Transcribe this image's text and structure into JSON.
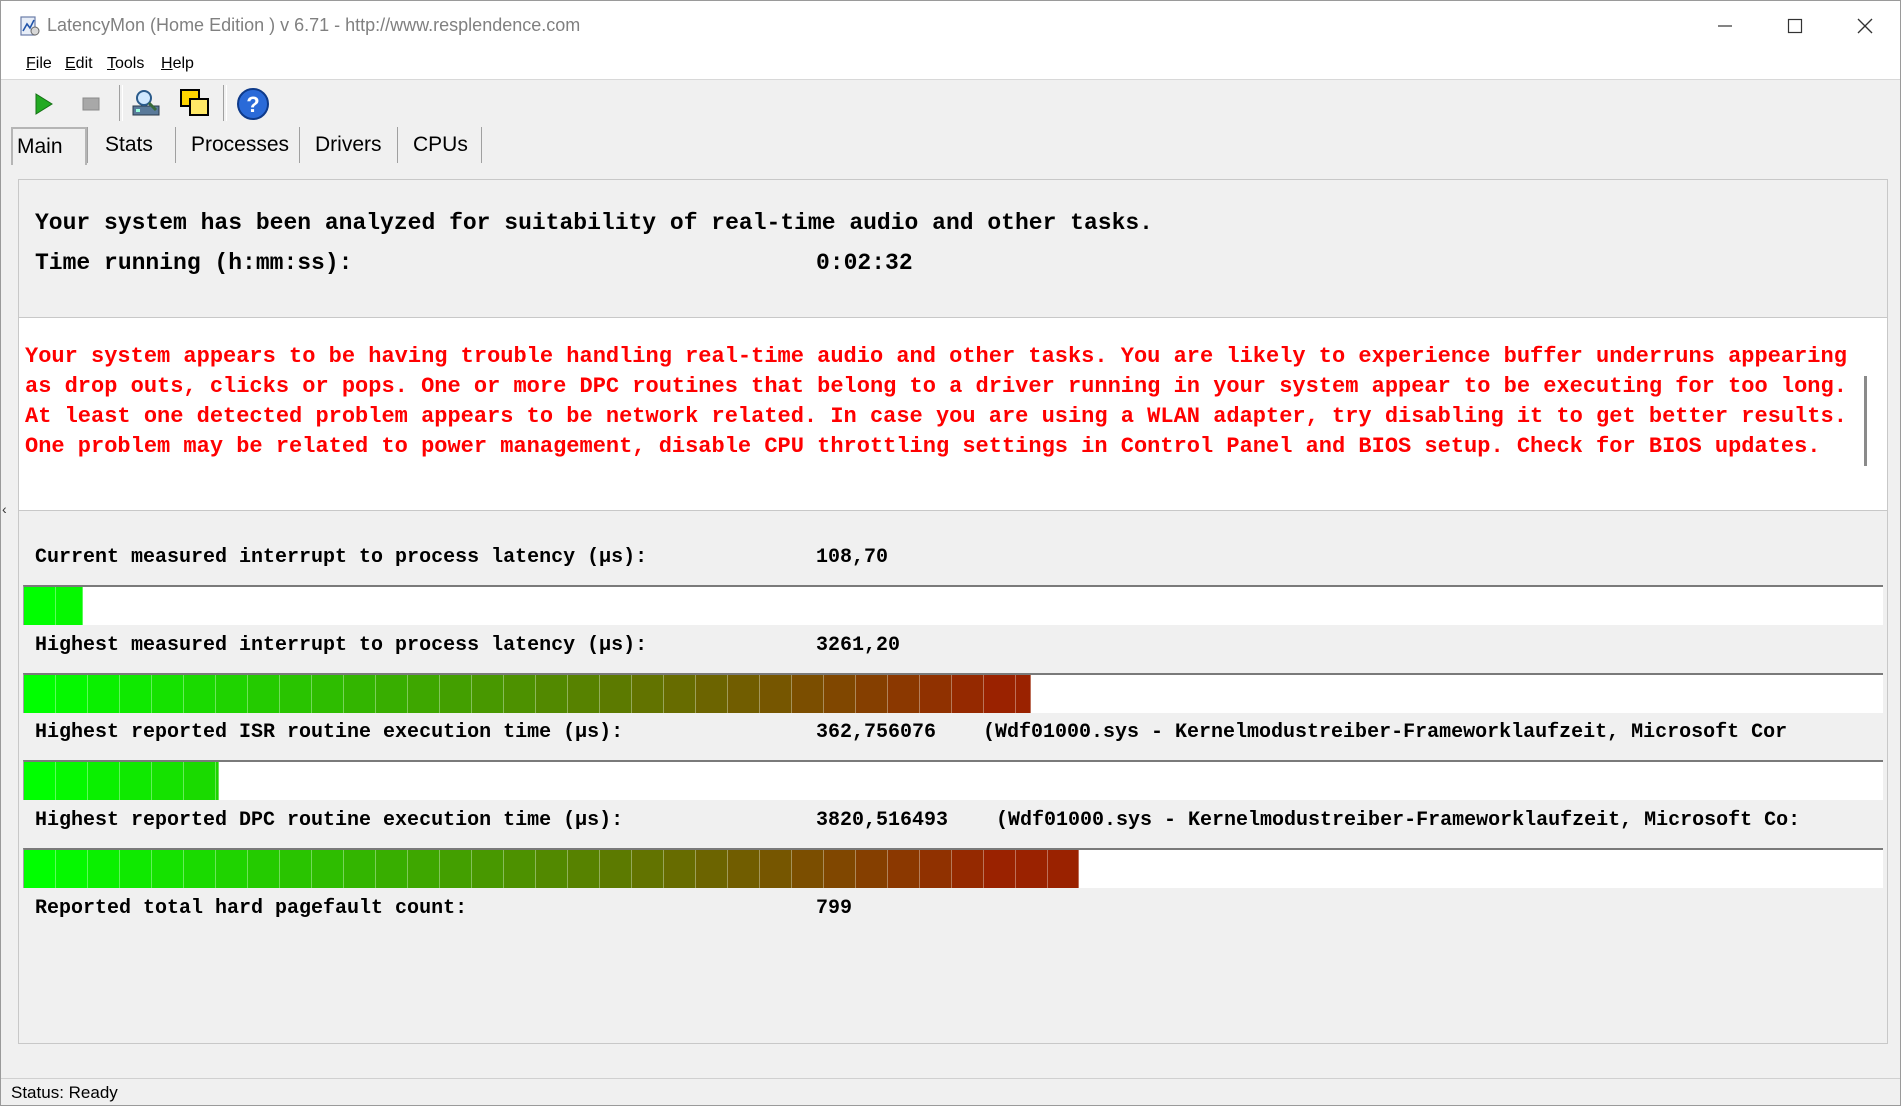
{
  "window": {
    "title": "LatencyMon  (Home Edition )  v 6.71 - http://www.resplendence.com"
  },
  "menu": [
    {
      "label": "File",
      "mnemonic": "F",
      "rest": "ile"
    },
    {
      "label": "Edit",
      "mnemonic": "E",
      "rest": "dit"
    },
    {
      "label": "Tools",
      "mnemonic": "T",
      "rest": "ools"
    },
    {
      "label": "Help",
      "mnemonic": "H",
      "rest": "elp"
    }
  ],
  "toolbar": {
    "icons": [
      "play-icon",
      "stop-icon",
      "driver-search-icon",
      "windows-icon",
      "help-icon"
    ]
  },
  "tabs": [
    "Main",
    "Stats",
    "Processes",
    "Drivers",
    "CPUs"
  ],
  "active_tab": "Main",
  "summary": {
    "line1": "Your system has been analyzed for suitability of real-time audio and other tasks.",
    "time_label": "Time running (h:mm:ss):",
    "time_value": "0:02:32"
  },
  "warning": {
    "text": "Your system appears to be having trouble handling real-time audio and other tasks. You are likely to experience buffer underruns appearing as drop outs, clicks or pops. One or more DPC routines that belong to a driver running in your system appear to be executing for too long. At least one detected problem appears to be network related. In case you are using a WLAN adapter, try disabling it to get better results. One problem may be related to power management, disable CPU throttling settings in Control Panel and BIOS setup. Check for BIOS updates.",
    "color": "#ff0000"
  },
  "metrics": [
    {
      "label": "Current measured interrupt to process latency (µs):",
      "value": "108,70",
      "extra": "",
      "bar_fraction": 0.032
    },
    {
      "label": "Highest measured interrupt to process latency (µs):",
      "value": "3261,20",
      "extra": "",
      "bar_fraction": 0.542
    },
    {
      "label": "Highest reported ISR routine execution time (µs):",
      "value": "362,756076",
      "extra": "(Wdf01000.sys - Kernelmodustreiber-Frameworklaufzeit, Microsoft Cor",
      "bar_fraction": 0.105
    },
    {
      "label": "Highest reported DPC routine execution time (µs):",
      "value": "3820,516493",
      "extra": "(Wdf01000.sys - Kernelmodustreiber-Frameworklaufzeit, Microsoft Co:",
      "bar_fraction": 0.568
    }
  ],
  "pagefault": {
    "label": "Reported total hard pagefault count:",
    "value": "799"
  },
  "status": {
    "text": "Status: Ready"
  },
  "colors": {
    "bar_start": "#00ff00",
    "bar_end": "#9a2200",
    "play": "#22aa22",
    "help": "#2a6ad8"
  }
}
